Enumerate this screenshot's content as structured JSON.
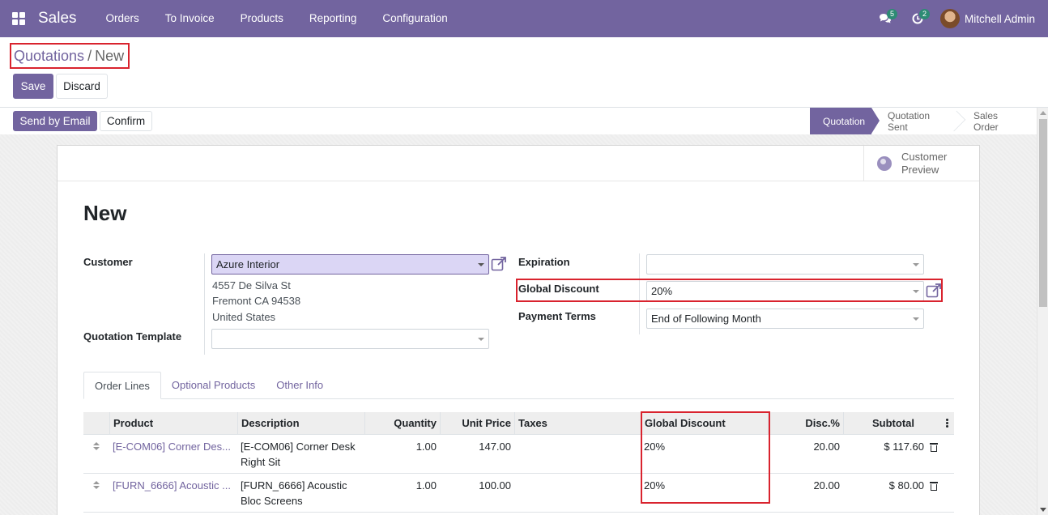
{
  "navbar": {
    "app_name": "Sales",
    "menu": [
      "Orders",
      "To Invoice",
      "Products",
      "Reporting",
      "Configuration"
    ],
    "messages_count": "5",
    "activities_count": "2",
    "user_name": "Mitchell Admin"
  },
  "breadcrumb": {
    "parent": "Quotations",
    "separator": "/",
    "current": "New"
  },
  "actions": {
    "save": "Save",
    "discard": "Discard",
    "send_email": "Send by Email",
    "confirm": "Confirm"
  },
  "statusbar": {
    "stages": [
      "Quotation",
      "Quotation Sent",
      "Sales Order"
    ],
    "active": "Quotation"
  },
  "sheet": {
    "customer_preview": [
      "Customer",
      "Preview"
    ],
    "title": "New",
    "customer_label": "Customer",
    "customer_value": "Azure Interior",
    "address": [
      "4557 De Silva St",
      "Fremont CA 94538",
      "United States"
    ],
    "quotation_template_label": "Quotation Template",
    "quotation_template_value": "",
    "expiration_label": "Expiration",
    "expiration_value": "",
    "global_discount_label": "Global Discount",
    "global_discount_value": "20%",
    "payment_terms_label": "Payment Terms",
    "payment_terms_value": "End of Following Month"
  },
  "tabs": [
    "Order Lines",
    "Optional Products",
    "Other Info"
  ],
  "order_lines": {
    "headers": {
      "product": "Product",
      "description": "Description",
      "quantity": "Quantity",
      "unit_price": "Unit Price",
      "taxes": "Taxes",
      "global_discount": "Global Discount",
      "disc": "Disc.%",
      "subtotal": "Subtotal"
    },
    "rows": [
      {
        "product": "[E-COM06] Corner Des...",
        "description": [
          "[E-COM06] Corner Desk",
          "Right Sit"
        ],
        "quantity": "1.00",
        "unit_price": "147.00",
        "taxes": "",
        "global_discount": "20%",
        "disc": "20.00",
        "subtotal": "$ 117.60"
      },
      {
        "product": "[FURN_6666] Acoustic ...",
        "description": [
          "[FURN_6666] Acoustic",
          "Bloc Screens"
        ],
        "quantity": "1.00",
        "unit_price": "100.00",
        "taxes": "",
        "global_discount": "20%",
        "disc": "20.00",
        "subtotal": "$ 80.00"
      }
    ]
  },
  "colors": {
    "brand": "#72649f",
    "highlight": "#d9232e",
    "badge": "#2d8b74"
  }
}
